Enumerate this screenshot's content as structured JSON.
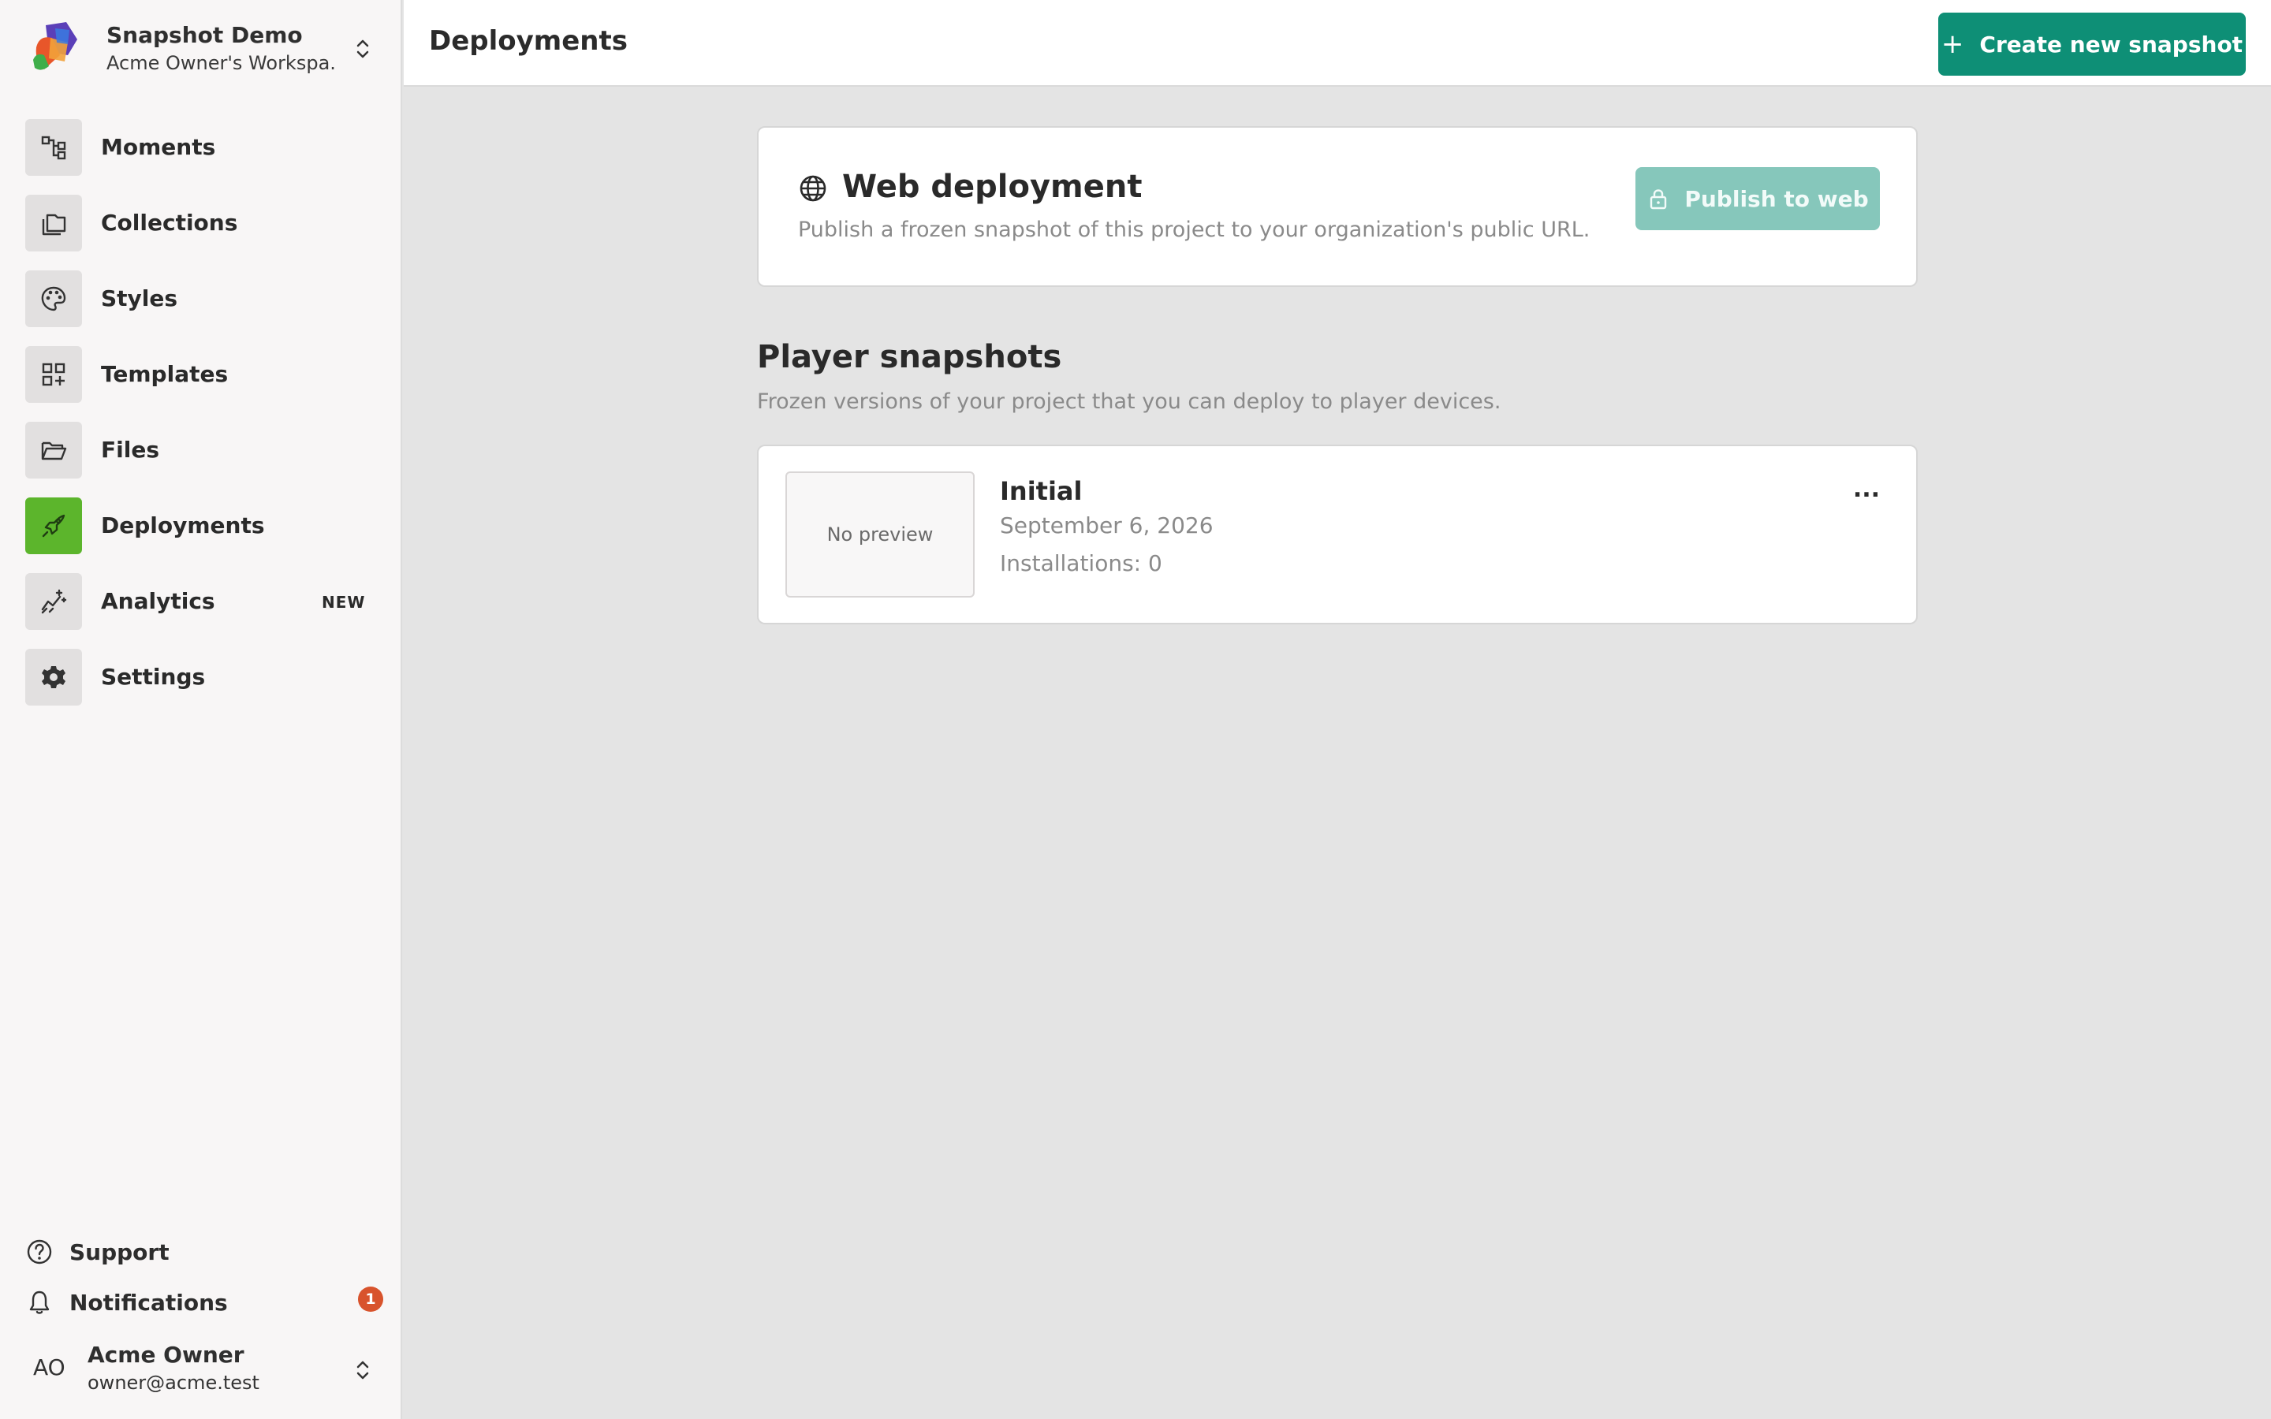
{
  "workspace": {
    "name": "Snapshot Demo",
    "owner": "Acme Owner's Workspa..."
  },
  "nav": {
    "items": [
      {
        "label": "Moments",
        "icon": "moments-icon"
      },
      {
        "label": "Collections",
        "icon": "collections-icon"
      },
      {
        "label": "Styles",
        "icon": "palette-icon"
      },
      {
        "label": "Templates",
        "icon": "templates-icon"
      },
      {
        "label": "Files",
        "icon": "folder-icon"
      },
      {
        "label": "Deployments",
        "icon": "rocket-icon",
        "active": true
      },
      {
        "label": "Analytics",
        "icon": "analytics-icon",
        "badge": "NEW"
      },
      {
        "label": "Settings",
        "icon": "gear-icon"
      }
    ]
  },
  "footer": {
    "support": "Support",
    "notifications": "Notifications",
    "notification_count": "1",
    "user_initials": "AO",
    "user_name": "Acme Owner",
    "user_email": "owner@acme.test"
  },
  "header": {
    "title": "Deployments",
    "create_button": "Create new snapshot",
    "create_icon": "+"
  },
  "web_deployment": {
    "title": "Web deployment",
    "description": "Publish a frozen snapshot of this project to your organization's public URL.",
    "publish_button": "Publish to web"
  },
  "player_snapshots": {
    "title": "Player snapshots",
    "description": "Frozen versions of your project that you can deploy to player devices.",
    "items": [
      {
        "name": "Initial",
        "date": "September 6, 2026",
        "installations": "Installations: 0",
        "preview": "No preview",
        "more": "..."
      }
    ]
  },
  "colors": {
    "accent": "#0e8f76",
    "accent_disabled": "#86c7bb",
    "nav_active": "#5cb52c",
    "badge": "#d8532c"
  }
}
